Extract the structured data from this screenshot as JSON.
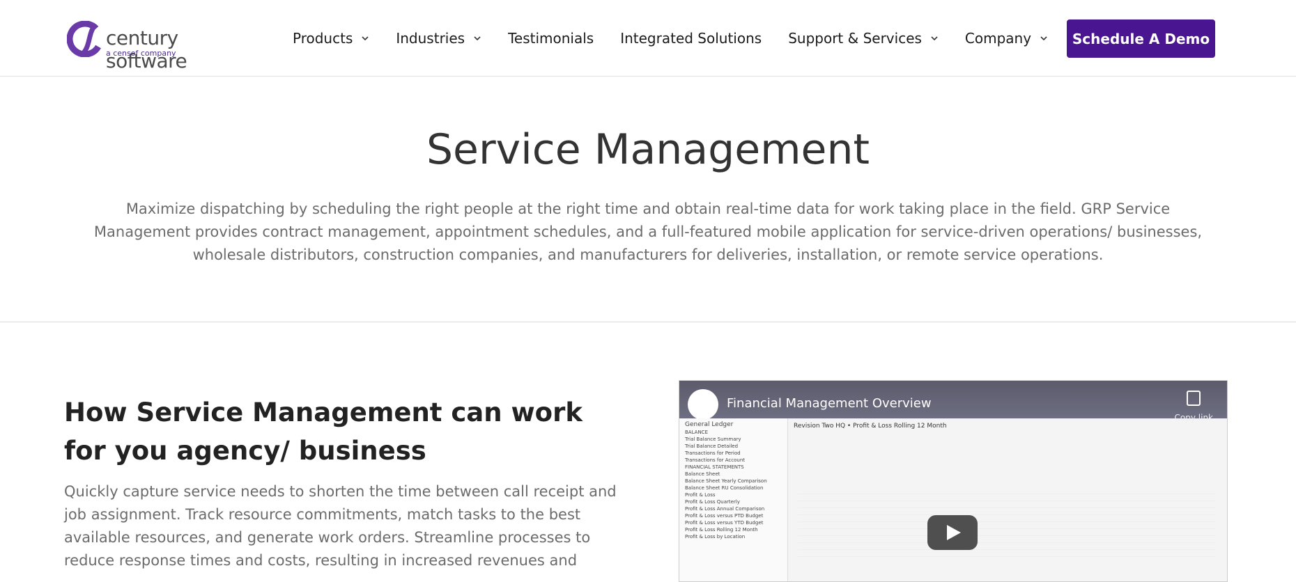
{
  "header": {
    "logo_text": "century software",
    "logo_sub": "a censof company",
    "nav": [
      {
        "label": "Products",
        "has_dropdown": true
      },
      {
        "label": "Industries",
        "has_dropdown": true
      },
      {
        "label": "Testimonials",
        "has_dropdown": false
      },
      {
        "label": "Integrated Solutions",
        "has_dropdown": false
      },
      {
        "label": "Support & Services",
        "has_dropdown": true
      },
      {
        "label": "Company",
        "has_dropdown": true
      }
    ],
    "cta_label": "Schedule A Demo",
    "cta_color": "#4a1590"
  },
  "hero": {
    "title": "Service Management",
    "description": "Maximize dispatching by scheduling the right people at the right time and obtain real-time data for work taking place in the field. GRP Service Management provides contract management, appointment schedules, and a full-featured mobile application for service-driven operations/ businesses, wholesale distributors, construction companies, and manufacturers for deliveries, installation, or remote service operations."
  },
  "section": {
    "title": "How Service Management can work for you agency/ business",
    "body": "Quickly capture service needs to shorten the time between call receipt and job assignment. Track resource commitments, match tasks to the best available resources, and generate work orders. Streamline processes to reduce response times and costs, resulting in increased revenues and"
  },
  "video": {
    "title": "Financial Management Overview",
    "copy_label": "Copy link",
    "sidebar_header": "General Ledger",
    "report_title": "Revision Two HQ • Profit & Loss Rolling 12 Month",
    "sidebar_items": [
      "BALANCE",
      "Trial Balance Summary",
      "Trial Balance Detailed",
      "Transactions for Period",
      "Transactions for Account",
      "FINANCIAL STATEMENTS",
      "Balance Sheet",
      "Balance Sheet Yearly Comparison",
      "Balance Sheet RU Consolidation",
      "Profit & Loss",
      "Profit & Loss Quarterly",
      "Profit & Loss Annual Comparison",
      "Profit & Loss versus PTD Budget",
      "Profit & Loss versus YTD Budget",
      "Profit & Loss Rolling 12 Month",
      "Profit & Loss by Location"
    ]
  }
}
